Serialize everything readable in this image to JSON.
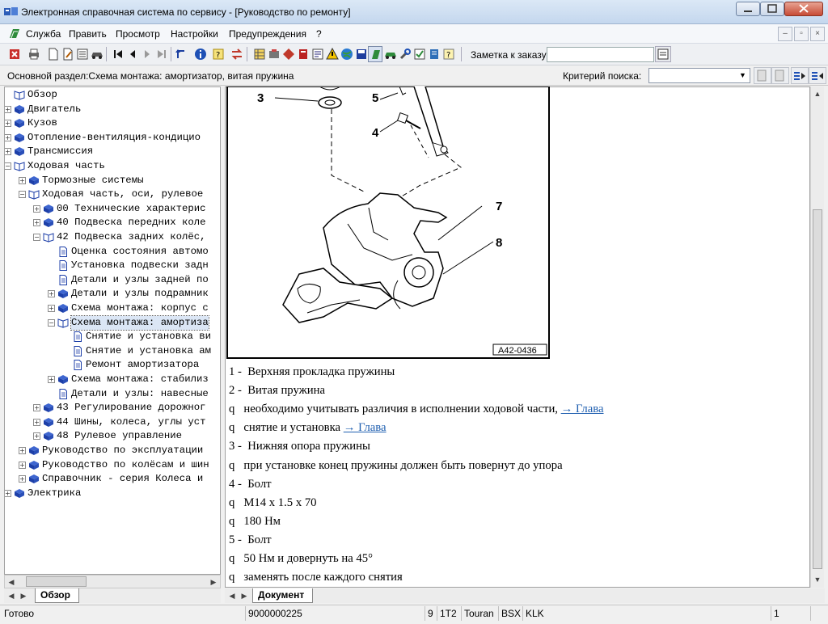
{
  "window": {
    "title": "Электронная справочная система по сервису - [Руководство по ремонту]",
    "buttons": [
      "minimize",
      "maximize",
      "close"
    ]
  },
  "menu": {
    "items": [
      "Служба",
      "Править",
      "Просмотр",
      "Настройки",
      "Предупреждения",
      "?"
    ]
  },
  "toolbar": {
    "note_label": "Заметка к заказу:",
    "note_value": ""
  },
  "section_bar": {
    "main_section": "Основной раздел:Схема монтажа: амортизатор, витая пружина",
    "criteria_label": "Критерий  поиска:",
    "criteria_value": ""
  },
  "tree": [
    {
      "label": "Обзор",
      "level": 0,
      "icon": "open-book",
      "toggle": "none"
    },
    {
      "label": "Двигатель",
      "level": 0,
      "icon": "book",
      "toggle": "plus"
    },
    {
      "label": "Кузов",
      "level": 0,
      "icon": "book",
      "toggle": "plus"
    },
    {
      "label": "Отопление-вентиляция-кондицио",
      "level": 0,
      "icon": "book",
      "toggle": "plus"
    },
    {
      "label": "Трансмиссия",
      "level": 0,
      "icon": "book",
      "toggle": "plus"
    },
    {
      "label": "Ходовая часть",
      "level": 0,
      "icon": "open-book",
      "toggle": "minus"
    },
    {
      "label": "Тормозные системы",
      "level": 1,
      "icon": "book",
      "toggle": "plus"
    },
    {
      "label": "Ходовая часть, оси, рулевое",
      "level": 1,
      "icon": "open-book",
      "toggle": "minus"
    },
    {
      "label": "00 Технические характерис",
      "level": 2,
      "icon": "book",
      "toggle": "plus"
    },
    {
      "label": "40 Подвеска передних коле",
      "level": 2,
      "icon": "book",
      "toggle": "plus"
    },
    {
      "label": "42 Подвеска задних колёс,",
      "level": 2,
      "icon": "open-book",
      "toggle": "minus"
    },
    {
      "label": "Оценка состояния автомо",
      "level": 3,
      "icon": "page",
      "toggle": "none"
    },
    {
      "label": "Установка подвески задн",
      "level": 3,
      "icon": "page",
      "toggle": "none"
    },
    {
      "label": "Детали и узлы задней по",
      "level": 3,
      "icon": "page",
      "toggle": "none"
    },
    {
      "label": "Детали и узлы подрамник",
      "level": 3,
      "icon": "book",
      "toggle": "plus"
    },
    {
      "label": "Схема монтажа: корпус с",
      "level": 3,
      "icon": "book",
      "toggle": "plus"
    },
    {
      "label": "Схема монтажа: амортиза",
      "level": 3,
      "icon": "open-book",
      "toggle": "minus",
      "selected": true
    },
    {
      "label": "Снятие и установка ви",
      "level": 4,
      "icon": "page",
      "toggle": "none"
    },
    {
      "label": "Снятие и установка ам",
      "level": 4,
      "icon": "page",
      "toggle": "none"
    },
    {
      "label": "Ремонт амортизатора",
      "level": 4,
      "icon": "page",
      "toggle": "none"
    },
    {
      "label": "Схема монтажа: стабилиз",
      "level": 3,
      "icon": "book",
      "toggle": "plus"
    },
    {
      "label": "Детали и узлы: навесные",
      "level": 3,
      "icon": "page",
      "toggle": "none"
    },
    {
      "label": "43 Регулирование дорожног",
      "level": 2,
      "icon": "book",
      "toggle": "plus"
    },
    {
      "label": "44 Шины, колеса, углы уст",
      "level": 2,
      "icon": "book",
      "toggle": "plus"
    },
    {
      "label": "48 Рулевое управление",
      "level": 2,
      "icon": "book",
      "toggle": "plus"
    },
    {
      "label": "Руководство по эксплуатации",
      "level": 1,
      "icon": "book",
      "toggle": "plus"
    },
    {
      "label": "Руководство по колёсам и шин",
      "level": 1,
      "icon": "book",
      "toggle": "plus"
    },
    {
      "label": "Справочник - серия Колеса и",
      "level": 1,
      "icon": "book",
      "toggle": "plus"
    },
    {
      "label": "Электрика",
      "level": 0,
      "icon": "book",
      "toggle": "plus"
    }
  ],
  "left_tabs": {
    "active": "Обзор"
  },
  "right_tabs": {
    "active": "Документ"
  },
  "diagram": {
    "callouts": [
      "3",
      "5",
      "4",
      "7",
      "8"
    ],
    "figure_id": "A42-0436"
  },
  "document": {
    "lines": [
      {
        "text": "1 -  Верхняя прокладка пружины"
      },
      {
        "text": "2 -  Витая пружина"
      },
      {
        "text": "q   необходимо учитывать различия в исполнении ходовой части, ",
        "link": "→ Глава"
      },
      {
        "text": "q   снятие и установка ",
        "link": "→ Глава"
      },
      {
        "text": "3 -  Нижняя опора пружины"
      },
      {
        "text": "q   при установке конец пружины должен быть повернут до упора"
      },
      {
        "text": "4 -  Болт"
      },
      {
        "text": "q   M14 x 1.5 x 70"
      },
      {
        "text": "q   180 Нм"
      },
      {
        "text": "5 -  Болт"
      },
      {
        "text": "q   50 Нм и довернуть на 45°"
      },
      {
        "text": "q   заменять после каждого снятия"
      }
    ]
  },
  "statusbar": {
    "status": "Готово",
    "vin": "9000000225",
    "model_year": "9",
    "model_code": "1T2",
    "model_name": "Touran",
    "engine": "BSX",
    "gearbox": "KLK",
    "page": "1"
  },
  "colors": {
    "link": "#1f5fb0",
    "book_icon": "#1d3fa8",
    "selection": "#dbe6f5"
  }
}
